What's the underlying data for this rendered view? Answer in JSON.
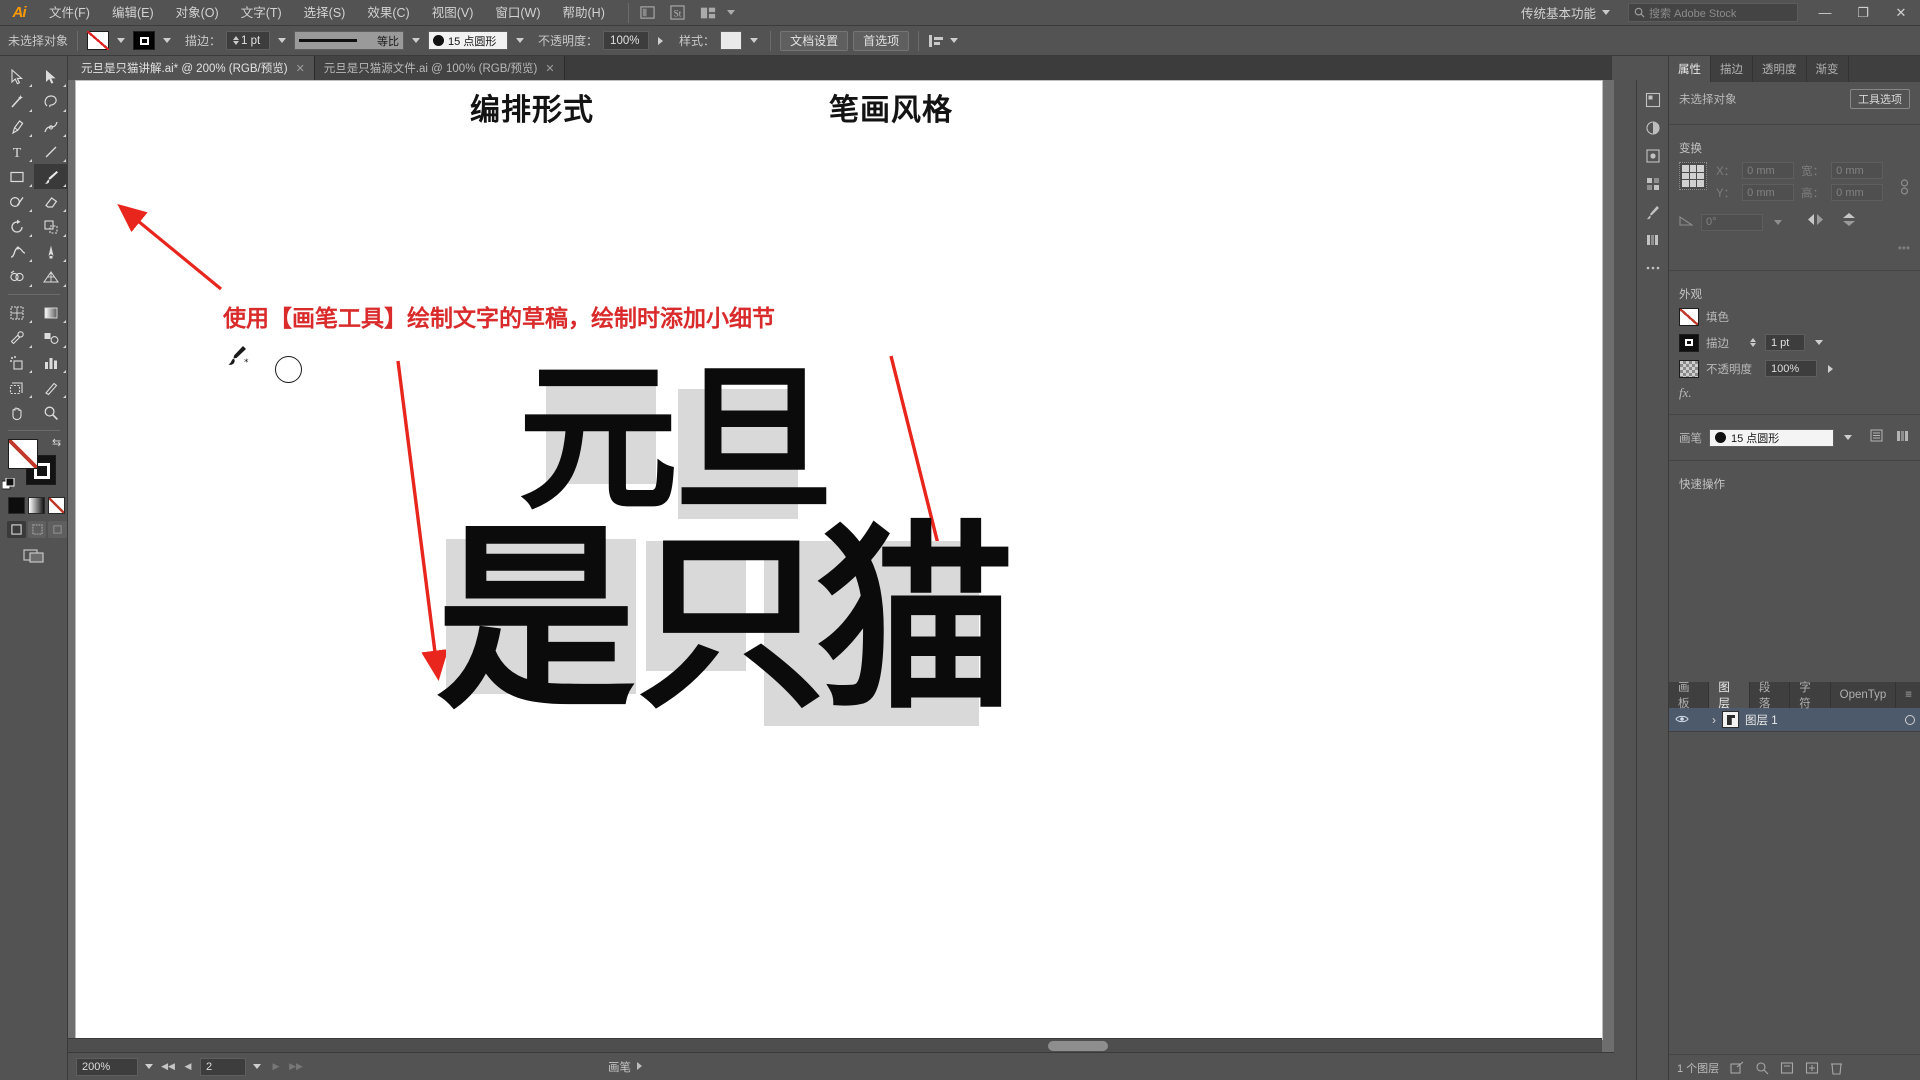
{
  "app": {
    "name": "Adobe Illustrator",
    "logo_text": "Ai"
  },
  "menubar": {
    "items": [
      {
        "label": "文件(F)"
      },
      {
        "label": "编辑(E)"
      },
      {
        "label": "对象(O)"
      },
      {
        "label": "文字(T)"
      },
      {
        "label": "选择(S)"
      },
      {
        "label": "效果(C)"
      },
      {
        "label": "视图(V)"
      },
      {
        "label": "窗口(W)"
      },
      {
        "label": "帮助(H)"
      }
    ],
    "workspace": "传统基本功能",
    "search_placeholder": "搜索 Adobe Stock",
    "window_buttons": {
      "minimize": "—",
      "restore": "❐",
      "close": "✕"
    }
  },
  "controlbar": {
    "selection_status": "未选择对象",
    "fill_label": "填色",
    "stroke_label": "描边：",
    "stroke_weight": "1 pt",
    "profile_label": "等比",
    "brush_name": "15 点圆形",
    "opacity_label": "不透明度：",
    "opacity_value": "100%",
    "style_label": "样式：",
    "doc_setup_button": "文档设置",
    "preferences_button": "首选项",
    "align_label": "对齐"
  },
  "tabs": [
    {
      "title": "元旦是只猫讲解.ai* @ 200% (RGB/预览)",
      "active": true,
      "close": "✕"
    },
    {
      "title": "元旦是只猫源文件.ai @ 100% (RGB/预览)",
      "active": false,
      "close": "✕"
    }
  ],
  "toolbar": {
    "tools": [
      {
        "name": "selection-tool",
        "row": 0,
        "col": 0
      },
      {
        "name": "direct-selection-tool",
        "row": 0,
        "col": 1
      },
      {
        "name": "magic-wand-tool",
        "row": 1,
        "col": 0
      },
      {
        "name": "lasso-tool",
        "row": 1,
        "col": 1
      },
      {
        "name": "pen-tool",
        "row": 2,
        "col": 0
      },
      {
        "name": "curvature-tool",
        "row": 2,
        "col": 1
      },
      {
        "name": "type-tool",
        "row": 3,
        "col": 0
      },
      {
        "name": "line-segment-tool",
        "row": 3,
        "col": 1
      },
      {
        "name": "rectangle-tool",
        "row": 4,
        "col": 0
      },
      {
        "name": "paintbrush-tool",
        "row": 4,
        "col": 1,
        "selected": true
      },
      {
        "name": "shaper-tool",
        "row": 5,
        "col": 0
      },
      {
        "name": "eraser-tool",
        "row": 5,
        "col": 1
      },
      {
        "name": "rotate-tool",
        "row": 6,
        "col": 0
      },
      {
        "name": "scale-tool",
        "row": 6,
        "col": 1
      },
      {
        "name": "width-tool",
        "row": 7,
        "col": 0
      },
      {
        "name": "free-transform-tool",
        "row": 7,
        "col": 1
      },
      {
        "name": "shape-builder-tool",
        "row": 8,
        "col": 0
      },
      {
        "name": "perspective-grid-tool",
        "row": 8,
        "col": 1
      },
      {
        "name": "mesh-tool",
        "row": 9,
        "col": 0
      },
      {
        "name": "gradient-tool",
        "row": 9,
        "col": 1
      },
      {
        "name": "eyedropper-tool",
        "row": 10,
        "col": 0
      },
      {
        "name": "blend-tool",
        "row": 10,
        "col": 1
      },
      {
        "name": "symbol-sprayer-tool",
        "row": 11,
        "col": 0
      },
      {
        "name": "column-graph-tool",
        "row": 11,
        "col": 1
      },
      {
        "name": "artboard-tool",
        "row": 12,
        "col": 0
      },
      {
        "name": "slice-tool",
        "row": 12,
        "col": 1
      },
      {
        "name": "hand-tool",
        "row": 13,
        "col": 0
      },
      {
        "name": "zoom-tool",
        "row": 13,
        "col": 1
      }
    ],
    "fill_stroke": {
      "fill": "none",
      "stroke": "#000000",
      "swap_icon": "⇆"
    },
    "color_modes": [
      "color-mode",
      "gradient-mode",
      "none-mode"
    ],
    "draw_modes": [
      "draw-normal",
      "draw-behind",
      "draw-inside"
    ],
    "screen_mode": "change-screen-mode"
  },
  "canvas": {
    "headers": [
      {
        "text": "编排形式"
      },
      {
        "text": "笔画风格"
      }
    ],
    "annotation": "使用【画笔工具】绘制文字的草稿，绘制时添加小细节",
    "annotation_color": "#d92b2b",
    "artwork_glyphs": [
      "元",
      "旦",
      "是",
      "只",
      "猫"
    ],
    "artwork_caption": "元旦是只猫",
    "arrows": 3
  },
  "statusbar": {
    "zoom": "200%",
    "page": "2",
    "current_tool": "画笔",
    "nav_first": "◀◀",
    "nav_prev": "◀",
    "nav_next": "▶",
    "nav_last": "▶▶"
  },
  "dock_icons": [
    {
      "name": "color-panel-icon"
    },
    {
      "name": "color-guide-icon"
    },
    {
      "name": "symbols-panel-icon"
    },
    {
      "name": "swatches-panel-icon"
    },
    {
      "name": "brushes-panel-icon"
    },
    {
      "name": "libraries-panel-icon"
    },
    {
      "name": "more-panels-icon"
    }
  ],
  "properties_panel": {
    "tabs": [
      {
        "label": "属性",
        "active": true
      },
      {
        "label": "描边",
        "active": false
      },
      {
        "label": "透明度",
        "active": false
      },
      {
        "label": "渐变",
        "active": false
      }
    ],
    "selection_status": "未选择对象",
    "tool_options_button": "工具选项",
    "transform": {
      "title": "变换",
      "x_label": "X：",
      "x_value": "0 mm",
      "y_label": "Y：",
      "y_value": "0 mm",
      "w_label": "宽：",
      "w_value": "0 mm",
      "h_label": "高：",
      "h_value": "0 mm",
      "angle_label": "∠：",
      "angle_value": "0°",
      "more_options": "•••"
    },
    "appearance": {
      "title": "外观",
      "fill_label": "填色",
      "stroke_label": "描边",
      "stroke_value": "1 pt",
      "opacity_label": "不透明度",
      "opacity_value": "100%",
      "fx_label": "fx."
    },
    "brush": {
      "label": "画笔",
      "value": "15 点圆形"
    },
    "quick_actions": {
      "title": "快速操作"
    }
  },
  "layers_panel": {
    "tabs": [
      {
        "label": "画板",
        "active": false
      },
      {
        "label": "图层",
        "active": true
      },
      {
        "label": "段落",
        "active": false
      },
      {
        "label": "字符",
        "active": false
      },
      {
        "label": "OpenTyp",
        "active": false
      }
    ],
    "menu_icon": "≡",
    "rows": [
      {
        "visibility_icon": "eye-icon",
        "lock_icon": "",
        "expand_icon": "›",
        "name": "图层 1",
        "target_icon": "○"
      }
    ],
    "footer": {
      "count_label": "1 个图层",
      "icons": [
        "make-clipping-mask-icon",
        "make-release-icon",
        "create-sublayer-icon",
        "create-new-layer-icon",
        "delete-layer-icon"
      ]
    }
  },
  "colors": {
    "chrome_bg": "#535353",
    "panel_bg": "#535353",
    "canvas_bg": "#6e6e6e",
    "artboard_bg": "#ffffff",
    "accent_orange": "#ff9a00",
    "annotation_red": "#d92b2b",
    "layer_row_selected": "#4d5a6b",
    "artwork_shadow": "#d9d9d9"
  }
}
